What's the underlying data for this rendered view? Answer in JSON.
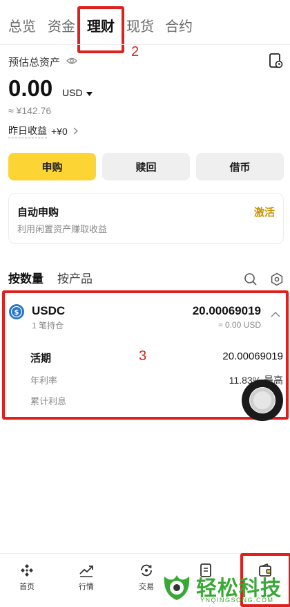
{
  "tabs": [
    {
      "label": "总览"
    },
    {
      "label": "资金"
    },
    {
      "label": "理财"
    },
    {
      "label": "现货"
    },
    {
      "label": "合约"
    }
  ],
  "annotations": {
    "tab_marker": "2",
    "row_marker": "3"
  },
  "summary": {
    "title": "预估总资产",
    "amount": "0.00",
    "currency": "USD",
    "approx": "≈ ¥142.76",
    "yesterday_label": "昨日收益",
    "yesterday_value": "+¥0"
  },
  "actions": {
    "subscribe": "申购",
    "redeem": "赎回",
    "borrow": "借币"
  },
  "auto_subscribe": {
    "title": "自动申购",
    "desc": "利用闲置资产赚取收益",
    "activate": "激活"
  },
  "list_tabs": {
    "by_quantity": "按数量",
    "by_product": "按产品"
  },
  "asset": {
    "name": "USDC",
    "positions": "1 笔持仓",
    "amount": "20.00069019",
    "approx": "≈ 0.00 USD",
    "term_label": "活期",
    "term_value": "20.00069019",
    "apr_label": "年利率",
    "apr_value": "11.83% 最高",
    "interest_label": "累计利息"
  },
  "bottom_nav": [
    {
      "label": "首页",
      "icon": "home-diamond-icon"
    },
    {
      "label": "行情",
      "icon": "market-chart-icon"
    },
    {
      "label": "交易",
      "icon": "trade-swap-icon"
    },
    {
      "label": "",
      "icon": "document-icon"
    },
    {
      "label": "",
      "icon": "wallet-icon"
    }
  ],
  "watermark": {
    "brand": "轻松科技",
    "url": "YNQINGSONG.COM"
  },
  "colors": {
    "accent_yellow": "#fcd535",
    "gold_text": "#c99400",
    "annotation_red": "#e0201c",
    "usdc_blue": "#2775ca"
  }
}
